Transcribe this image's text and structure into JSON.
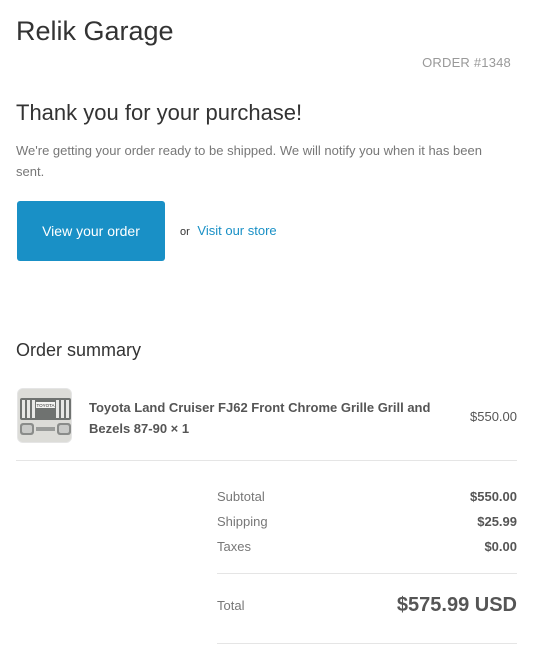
{
  "shop": {
    "name": "Relik Garage"
  },
  "order": {
    "number": "ORDER #1348"
  },
  "thanks": {
    "title": "Thank you for your purchase!",
    "message": "We're getting your order ready to be shipped. We will notify you when it has been sent."
  },
  "actions": {
    "view_order": "View your order",
    "or": "or",
    "visit_store": "Visit our store"
  },
  "summary": {
    "title": "Order summary",
    "items": [
      {
        "title": "Toyota Land Cruiser FJ62 Front Chrome Grille Grill and Bezels 87-90 × 1",
        "price": "$550.00",
        "thumb_text": "TOYOTA"
      }
    ],
    "subtotal_label": "Subtotal",
    "subtotal_value": "$550.00",
    "shipping_label": "Shipping",
    "shipping_value": "$25.99",
    "taxes_label": "Taxes",
    "taxes_value": "$0.00",
    "total_label": "Total",
    "total_value": "$575.99 USD"
  },
  "colors": {
    "accent": "#1990c6",
    "text": "#333333",
    "muted": "#777777",
    "divider": "#e5e5e5"
  }
}
